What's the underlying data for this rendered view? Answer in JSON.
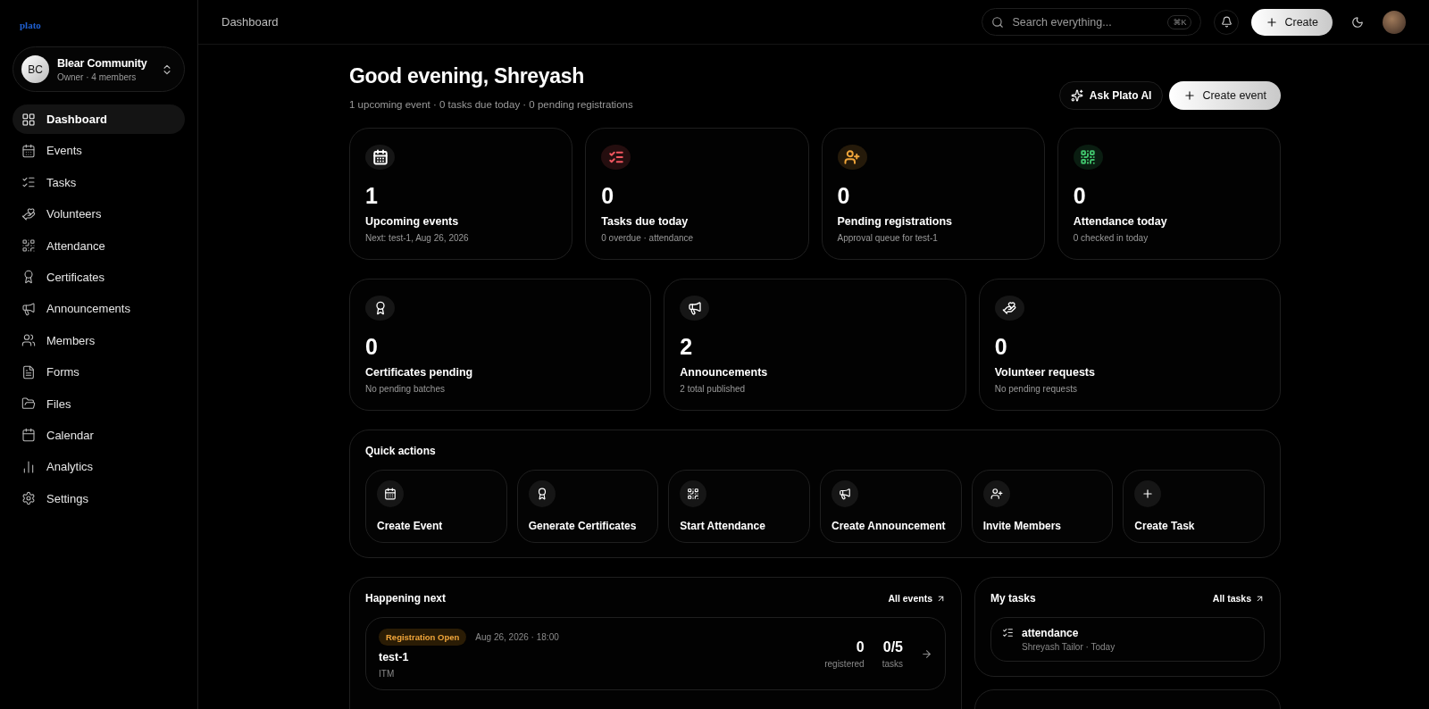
{
  "brand": "plato",
  "workspace": {
    "initials": "BC",
    "name": "Blear Community",
    "meta": "Owner · 4 members"
  },
  "nav": [
    {
      "label": "Dashboard",
      "selected": true
    },
    {
      "label": "Events",
      "selected": false
    },
    {
      "label": "Tasks",
      "selected": false
    },
    {
      "label": "Volunteers",
      "selected": false
    },
    {
      "label": "Attendance",
      "selected": false
    },
    {
      "label": "Certificates",
      "selected": false
    },
    {
      "label": "Announcements",
      "selected": false
    },
    {
      "label": "Members",
      "selected": false
    },
    {
      "label": "Forms",
      "selected": false
    },
    {
      "label": "Files",
      "selected": false
    },
    {
      "label": "Calendar",
      "selected": false
    },
    {
      "label": "Analytics",
      "selected": false
    },
    {
      "label": "Settings",
      "selected": false
    }
  ],
  "topbar": {
    "breadcrumb": "Dashboard",
    "search": {
      "placeholder": "Search everything...",
      "shortcut": "⌘K"
    },
    "create_label": "Create"
  },
  "greeting": {
    "title": "Good evening, Shreyash",
    "subtitle": "1 upcoming event · 0 tasks due today · 0 pending registrations",
    "ai_button": "Ask Plato AI",
    "create_button": "Create event"
  },
  "stats": [
    {
      "value": "1",
      "label": "Upcoming events",
      "note": "Next: test-1, Aug 26, 2026",
      "color": "#ffffff"
    },
    {
      "value": "0",
      "label": "Tasks due today",
      "note": "0 overdue · attendance",
      "color": "#f0565f"
    },
    {
      "value": "0",
      "label": "Pending registrations",
      "note": "Approval queue for test-1",
      "color": "#f0a53a"
    },
    {
      "value": "0",
      "label": "Attendance today",
      "note": "0 checked in today",
      "color": "#3fbf6a"
    }
  ],
  "stats_secondary": [
    {
      "value": "0",
      "label": "Certificates pending",
      "note": "No pending batches"
    },
    {
      "value": "2",
      "label": "Announcements",
      "note": "2 total published"
    },
    {
      "value": "0",
      "label": "Volunteer requests",
      "note": "No pending requests"
    }
  ],
  "quick_actions": {
    "title": "Quick actions",
    "items": [
      "Create Event",
      "Generate Certificates",
      "Start Attendance",
      "Create Announcement",
      "Invite Members",
      "Create Task"
    ]
  },
  "happening_next": {
    "title": "Happening next",
    "link": "All events",
    "events": [
      {
        "status": "Registration Open",
        "date": "Aug 26, 2026 · 18:00",
        "name": "test-1",
        "venue": "ITM",
        "registered": "0",
        "registered_label": "registered",
        "tasks": "0/5",
        "tasks_label": "tasks"
      }
    ]
  },
  "my_tasks": {
    "title": "My tasks",
    "link": "All tasks",
    "tasks": [
      {
        "title": "attendance",
        "meta": "Shreyash Tailor · Today"
      }
    ]
  }
}
